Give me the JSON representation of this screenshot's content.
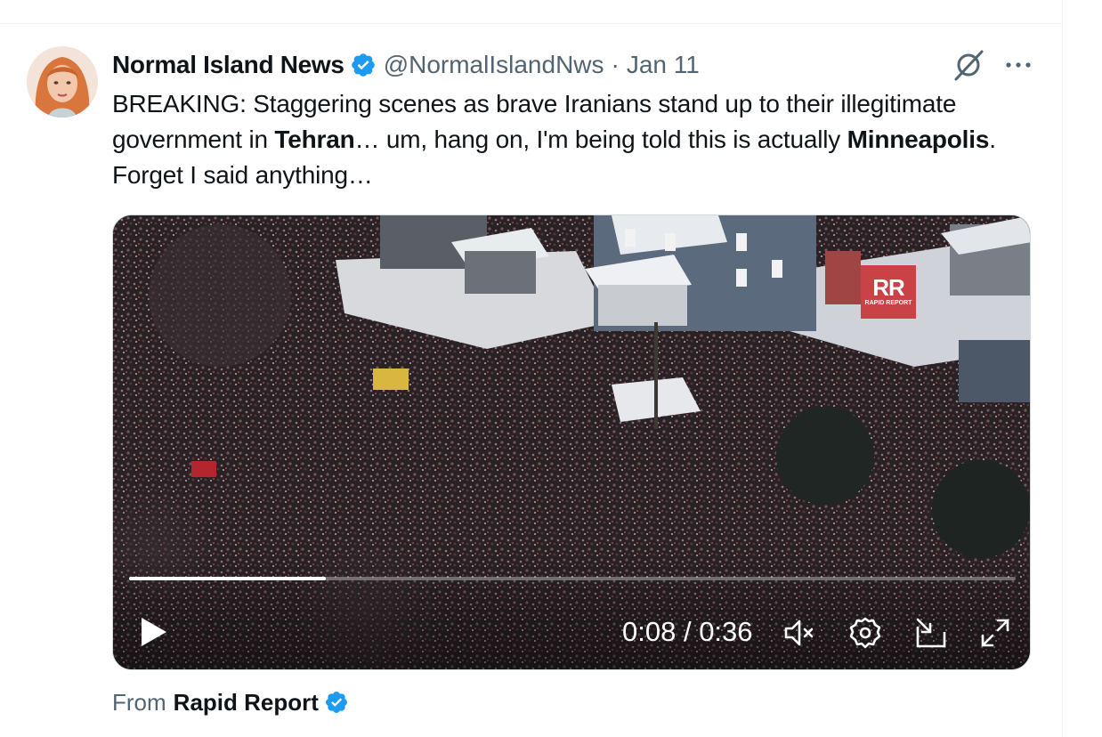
{
  "tweet": {
    "display_name": "Normal Island News",
    "handle": "@NormalIslandNws",
    "separator": "·",
    "date": "Jan 11",
    "text": {
      "part1": "BREAKING: Staggering scenes as brave Iranians stand up to their illegitimate government in ",
      "bold1": "Tehran",
      "part2": "… um, hang on, I'm being told this is actually ",
      "bold2": "Minneapolis",
      "part3": ". Forget I said anything…"
    }
  },
  "video": {
    "watermark": "RR",
    "watermark_sub": "RAPID REPORT",
    "current_time": "0:08",
    "duration": "0:36",
    "time_separator": " / ",
    "progress_fraction": 0.2222,
    "muted": true
  },
  "source": {
    "prefix": "From",
    "name": "Rapid Report"
  },
  "colors": {
    "verified_blue": "#1d9bf0",
    "secondary_text": "#536471",
    "watermark_red": "#c9363a"
  },
  "icons": {
    "grok": "grok-icon",
    "more": "more-icon",
    "play": "play-icon",
    "mute": "volume-muted-icon",
    "settings": "gear-icon",
    "pip": "picture-in-picture-icon",
    "fullscreen": "fullscreen-icon"
  }
}
